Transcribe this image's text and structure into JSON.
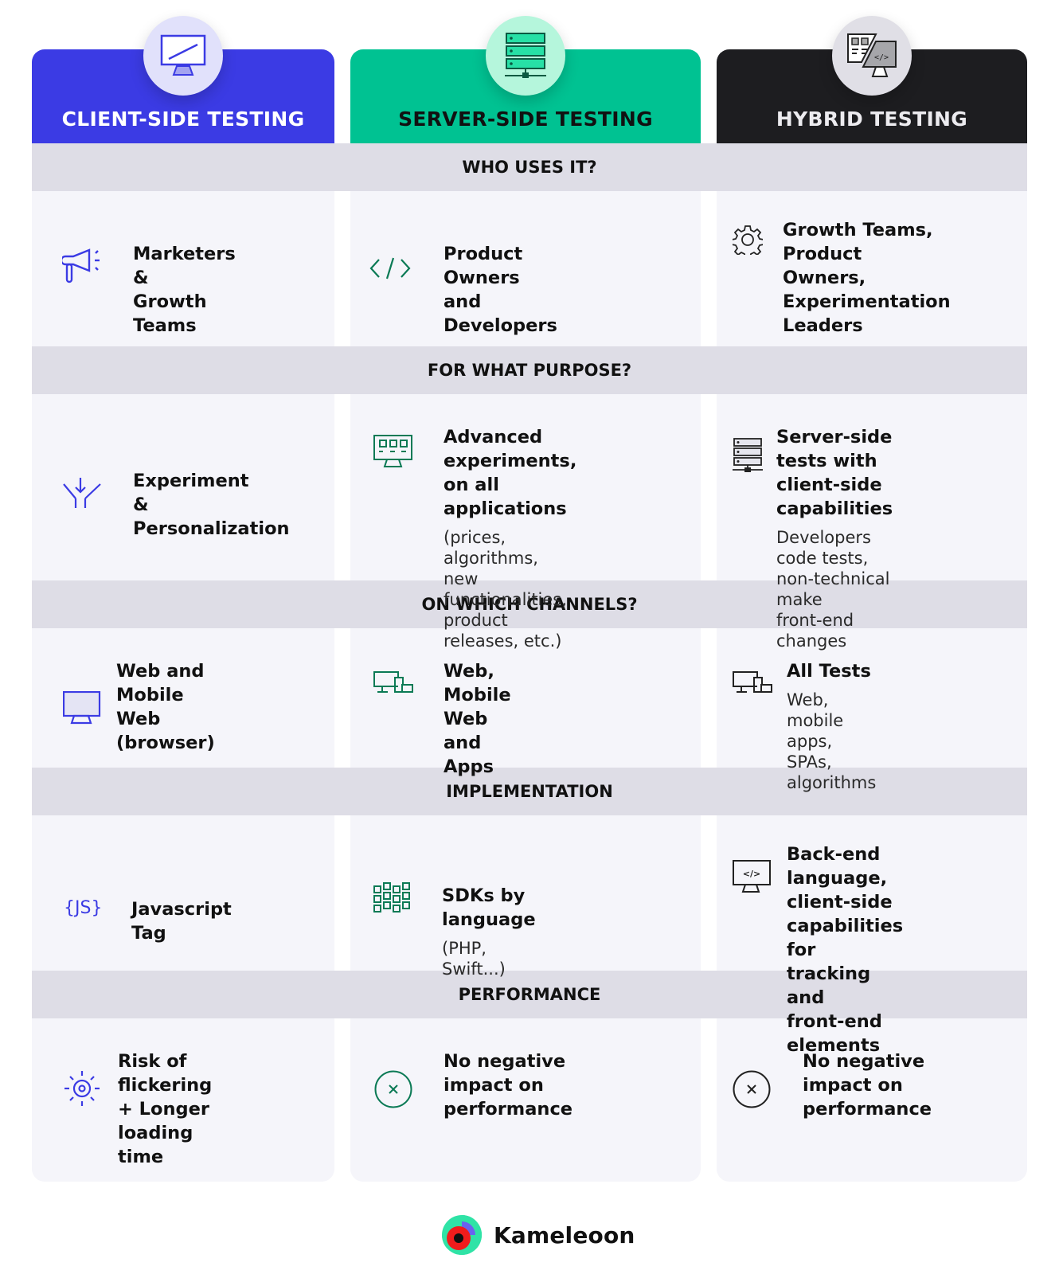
{
  "colors": {
    "client": "#3b3be4",
    "server": "#00c292",
    "hybrid": "#1d1d20",
    "band": "#dedde6",
    "cell_bg": "#f5f5fa"
  },
  "columns": [
    {
      "key": "client",
      "title": "CLIENT-SIDE TESTING",
      "icon": "monitor-icon"
    },
    {
      "key": "server",
      "title": "SERVER-SIDE TESTING",
      "icon": "server-rack-icon"
    },
    {
      "key": "hybrid",
      "title": "HYBRID TESTING",
      "icon": "hybrid-code-monitor-icon"
    }
  ],
  "sections": [
    {
      "title": "WHO USES IT?",
      "cells": [
        {
          "icon": "megaphone-icon",
          "title": [
            "Marketers &",
            "Growth Teams"
          ],
          "subtitle": []
        },
        {
          "icon": "code-icon",
          "title": [
            "Product Owners",
            "and Developers"
          ],
          "subtitle": []
        },
        {
          "icon": "gear-icon",
          "title": [
            "Growth Teams,",
            "Product Owners,",
            "Experimentation",
            "Leaders"
          ],
          "subtitle": []
        }
      ]
    },
    {
      "title": "FOR WHAT PURPOSE?",
      "cells": [
        {
          "icon": "split-arrow-icon",
          "title": [
            "Experiment",
            "& Personalization"
          ],
          "subtitle": []
        },
        {
          "icon": "dashboard-monitor-icon",
          "title": [
            "Advanced experiments,",
            "on all applications"
          ],
          "subtitle": [
            "(prices, algorithms, new",
            "functionalities, product",
            "releases, etc.)"
          ]
        },
        {
          "icon": "server-icon",
          "title": [
            "Server-side tests with",
            "client-side capabilities"
          ],
          "subtitle": [
            "Developers code tests,",
            "non-technical make",
            "front-end changes"
          ]
        }
      ]
    },
    {
      "title": "ON WHICH CHANNELS?",
      "cells": [
        {
          "icon": "monitor-icon",
          "title": [
            "Web and",
            "Mobile Web",
            "(browser)"
          ],
          "subtitle": []
        },
        {
          "icon": "devices-icon",
          "title": [
            "Web, Mobile",
            "Web and",
            "Apps"
          ],
          "subtitle": []
        },
        {
          "icon": "devices-icon",
          "title": [
            "All Tests"
          ],
          "subtitle": [
            "Web, mobile apps,",
            "SPAs, algorithms"
          ]
        }
      ]
    },
    {
      "title": "IMPLEMENTATION",
      "cells": [
        {
          "icon": "js-icon",
          "icon_text": "{JS}",
          "title": [
            "Javascript Tag"
          ],
          "subtitle": []
        },
        {
          "icon": "grid-blocks-icon",
          "title": [
            "SDKs by language"
          ],
          "subtitle": [
            "(PHP, Swift...)"
          ]
        },
        {
          "icon": "code-monitor-icon",
          "icon_text": "</>",
          "title": [
            "Back-end language,",
            "client-side capabilities",
            "for tracking and",
            "front-end elements"
          ],
          "subtitle": []
        }
      ]
    },
    {
      "title": "PERFORMANCE",
      "cells": [
        {
          "icon": "flicker-icon",
          "title": [
            "Risk of flickering",
            "+ Longer loading",
            "time"
          ],
          "subtitle": []
        },
        {
          "icon": "no-impact-icon",
          "title": [
            "No negative",
            "impact on",
            "performance"
          ],
          "subtitle": []
        },
        {
          "icon": "no-impact-icon",
          "title": [
            "No negative",
            "impact on",
            "performance"
          ],
          "subtitle": []
        }
      ]
    }
  ],
  "footer": {
    "brand": "Kameleoon"
  }
}
